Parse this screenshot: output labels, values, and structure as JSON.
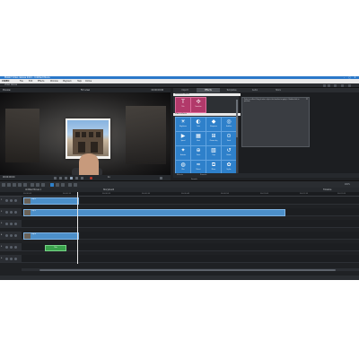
{
  "titlebar": {
    "title": "MAGIX Video deluxe 2021 - Untitled Movie",
    "min": "–",
    "max": "□",
    "close": "✕"
  },
  "menubar": {
    "logo": "VIDEO",
    "items": [
      "File",
      "Edit",
      "Effects",
      "Window",
      "Playback",
      "Help",
      "Online"
    ]
  },
  "toolbar": {
    "title": "Video deluxe"
  },
  "preview": {
    "left_label": "Preview",
    "title": "Film view",
    "timecode": "00:00:09:06"
  },
  "transport": {
    "timecode": "00:00:00:00",
    "speed": "1x"
  },
  "right_panel": {
    "tabs": [
      "Import",
      "Effects",
      "Templates",
      "Audio",
      "Store"
    ],
    "active_tab": 1,
    "sections": [
      "Featured effects",
      "Video effects"
    ],
    "featured": [
      {
        "label": "Title",
        "icon": "T"
      },
      {
        "label": "Transition",
        "icon": "✣"
      }
    ],
    "effects": [
      {
        "label": "Brightness",
        "icon": "☀"
      },
      {
        "label": "Color",
        "icon": "◐"
      },
      {
        "label": "Sharpness",
        "icon": "◆"
      },
      {
        "label": "Stabilize",
        "icon": "◎"
      },
      {
        "label": "Speed",
        "icon": "▶"
      },
      {
        "label": "Mask",
        "icon": "▦"
      },
      {
        "label": "Chroma key",
        "icon": "⊞"
      },
      {
        "label": "Travel",
        "icon": "⊙"
      },
      {
        "label": "Animate",
        "icon": "✦"
      },
      {
        "label": "Zoom",
        "icon": "⊕"
      },
      {
        "label": "Crop",
        "icon": "▧"
      },
      {
        "label": "Rotate",
        "icon": "↺"
      },
      {
        "label": "Blur",
        "icon": "◍"
      },
      {
        "label": "Distort",
        "icon": "≈"
      },
      {
        "label": "Mirror",
        "icon": "⧉"
      },
      {
        "label": "Stylize",
        "icon": "✿"
      }
    ],
    "description": "Select an effect. Drag it onto a clip in the timeline to apply it. Double-click to preview.",
    "bottom_labels": [
      "Effects",
      "Presets"
    ],
    "search_label": "Search"
  },
  "timeline": {
    "header_left": "Untitled Movie 1",
    "header_mid": "Storyboard",
    "header_right": "Timeline",
    "zoom": "100%",
    "ruler": [
      "00:00:00",
      "00:00:10",
      "00:00:20",
      "00:00:30",
      "00:00:40",
      "00:00:50",
      "00:01:00",
      "00:01:10",
      "00:01:20"
    ],
    "tracks": [
      "1",
      "2",
      "3",
      "4",
      "5",
      "6"
    ],
    "clips": [
      {
        "track": 0,
        "label": "Clip 1"
      },
      {
        "track": 1,
        "label": "Clip 2"
      },
      {
        "track": 3,
        "label": "Clip 3"
      }
    ],
    "fx_label": "Title"
  }
}
